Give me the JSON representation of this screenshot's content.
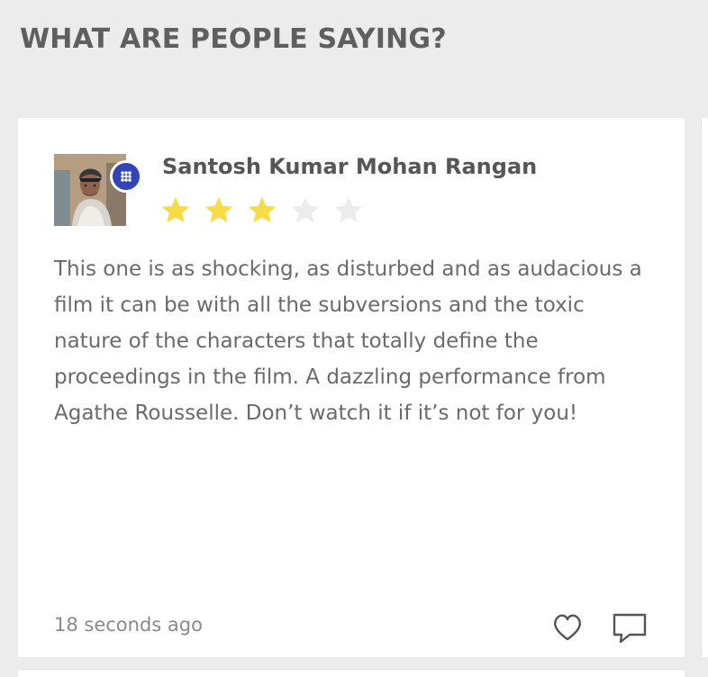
{
  "section": {
    "title": "WHAT ARE PEOPLE SAYING?"
  },
  "review": {
    "reviewer_name": "Santosh Kumar Mohan Rangan",
    "rating": 3,
    "max_rating": 5,
    "text": "This one is as shocking, as disturbed and as audacious a film it can be with all the subversions and the toxic nature of the characters that totally define the proceedings in the film. A dazzling performance from Agathe Rousselle. Don’t watch it if it’s not for you!",
    "timestamp": "18 seconds ago",
    "icons": {
      "avatar": "user-avatar",
      "badge": "app-badge-icon",
      "star": "star-icon",
      "like": "heart-icon",
      "comment": "comment-icon"
    }
  },
  "colors": {
    "background": "#ececec",
    "card": "#ffffff",
    "title": "#5f5f5f",
    "text": "#6a6a6a",
    "star_active": "#f6dc47",
    "star_inactive": "#ececec",
    "badge": "#3343b8"
  }
}
